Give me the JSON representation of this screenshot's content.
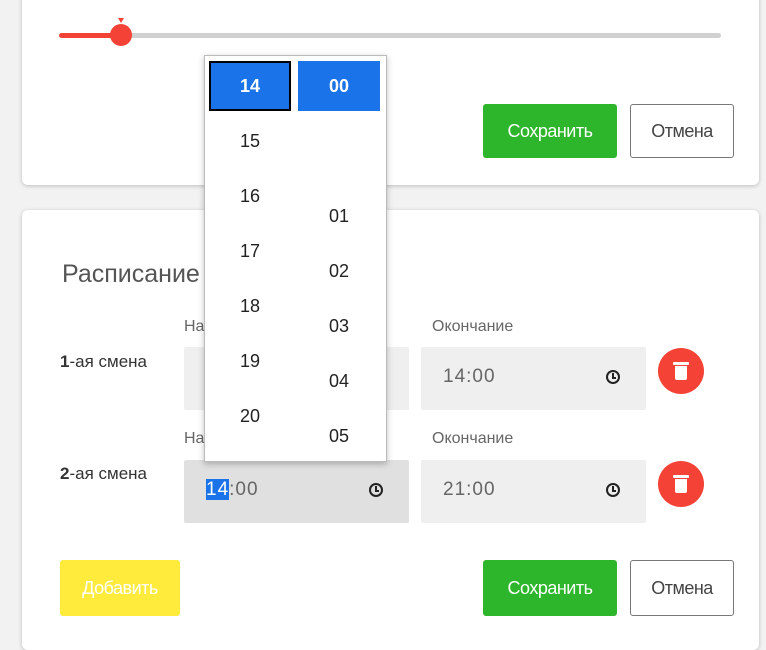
{
  "slider": {
    "value_fraction": 0.093,
    "color": "#f44336"
  },
  "top_card": {
    "save_label": "Сохранить",
    "cancel_label": "Отмена"
  },
  "schedule": {
    "title": "Расписание",
    "shifts": [
      {
        "num": "1",
        "label": "-ая смена",
        "start_label": "Начало",
        "start_value": "",
        "end_label": "Окончание",
        "end_value": "14:00"
      },
      {
        "num": "2",
        "label": "-ая смена",
        "start_label": "Начало",
        "start_value_selected": "14",
        "start_value_rest": ":00",
        "end_label": "Окончание",
        "end_value": "21:00"
      }
    ],
    "add_label": "Добавить",
    "save_label": "Сохранить",
    "cancel_label": "Отмена"
  },
  "picker": {
    "hours": [
      "14",
      "15",
      "16",
      "17",
      "18",
      "19",
      "20"
    ],
    "minutes": [
      "00",
      "01",
      "02",
      "03",
      "04",
      "05"
    ],
    "selected_hour": "14",
    "selected_minute": "00"
  },
  "colors": {
    "accent_green": "#2db52b",
    "accent_red": "#f44336",
    "accent_yellow": "#ffeb3b",
    "selection_blue": "#1a73e8"
  }
}
